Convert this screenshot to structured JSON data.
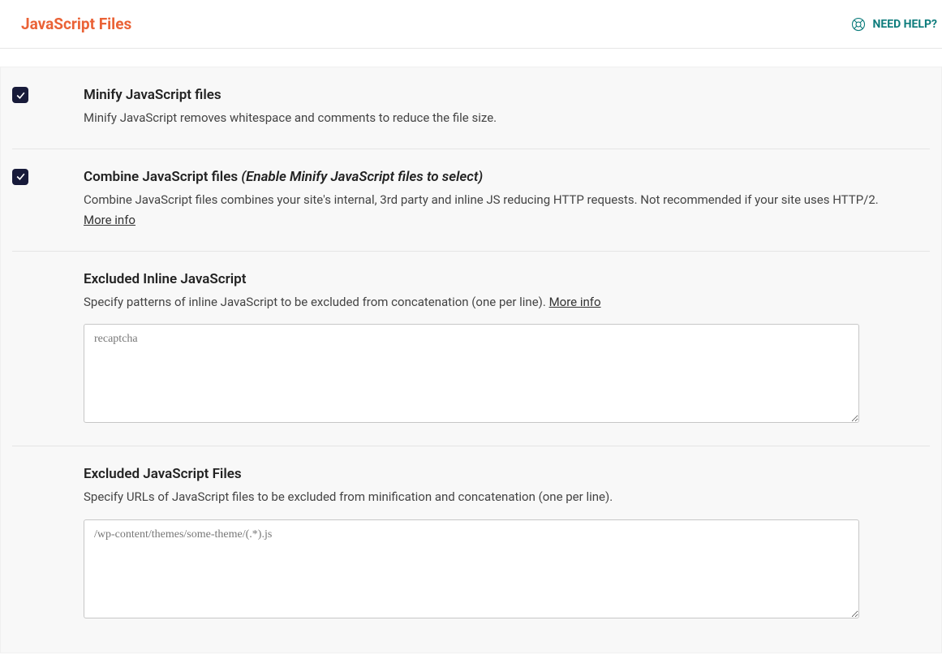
{
  "header": {
    "title": "JavaScript Files",
    "help_label": "NEED HELP?"
  },
  "minify": {
    "checked": true,
    "title": "Minify JavaScript files",
    "desc": "Minify JavaScript removes whitespace and comments to reduce the file size."
  },
  "combine": {
    "checked": true,
    "title": "Combine JavaScript files",
    "condition": "(Enable Minify JavaScript files to select)",
    "desc": "Combine JavaScript files combines your site's internal, 3rd party and inline JS reducing HTTP requests. Not recommended if your site uses HTTP/2.",
    "more_info": "More info"
  },
  "excluded_inline": {
    "heading": "Excluded Inline JavaScript",
    "sub": "Specify patterns of inline JavaScript to be excluded from concatenation (one per line).",
    "more_info": "More info",
    "placeholder": "recaptcha",
    "value": ""
  },
  "excluded_files": {
    "heading": "Excluded JavaScript Files",
    "sub": "Specify URLs of JavaScript files to be excluded from minification and concatenation (one per line).",
    "placeholder": "/wp-content/themes/some-theme/(.*).js",
    "value": ""
  }
}
